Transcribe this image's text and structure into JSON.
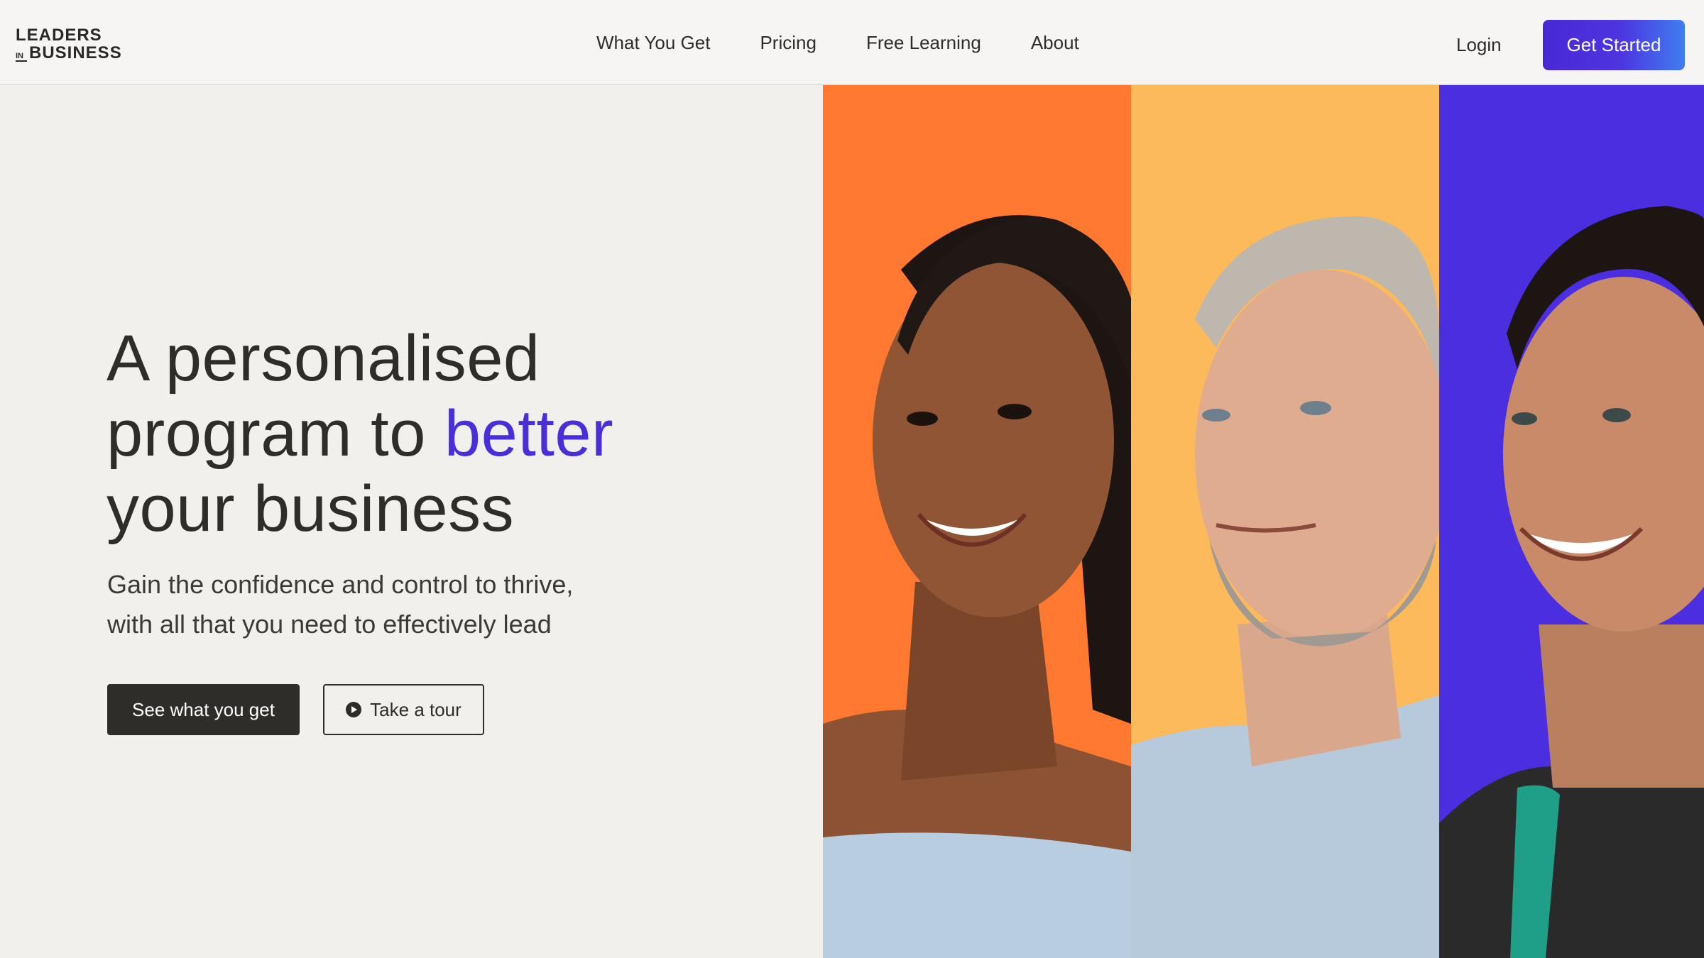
{
  "brand": {
    "logo_top": "LEADERS",
    "logo_in": "IN",
    "logo_bottom": "BUSINESS"
  },
  "nav": {
    "items": [
      {
        "label": "What You Get"
      },
      {
        "label": "Pricing"
      },
      {
        "label": "Free Learning"
      },
      {
        "label": "About"
      }
    ],
    "login": "Login",
    "cta": "Get Started"
  },
  "hero": {
    "headline_line1": "A personalised",
    "headline_line2_pre": "program to ",
    "headline_accent": "better",
    "headline_line3": "your business",
    "subline_line1": "Gain the confidence and control to thrive,",
    "subline_line2": "with all that you need to effectively lead",
    "primary_button": "See what you get",
    "secondary_button": "Take a tour"
  },
  "colors": {
    "accent": "#4a2fd9",
    "panel_orange": "#ff7a30",
    "panel_yellow": "#fdba5a",
    "panel_purple": "#4a2ee0",
    "dark": "#2f2d2a"
  },
  "icons": {
    "play": "play-circle-icon"
  }
}
